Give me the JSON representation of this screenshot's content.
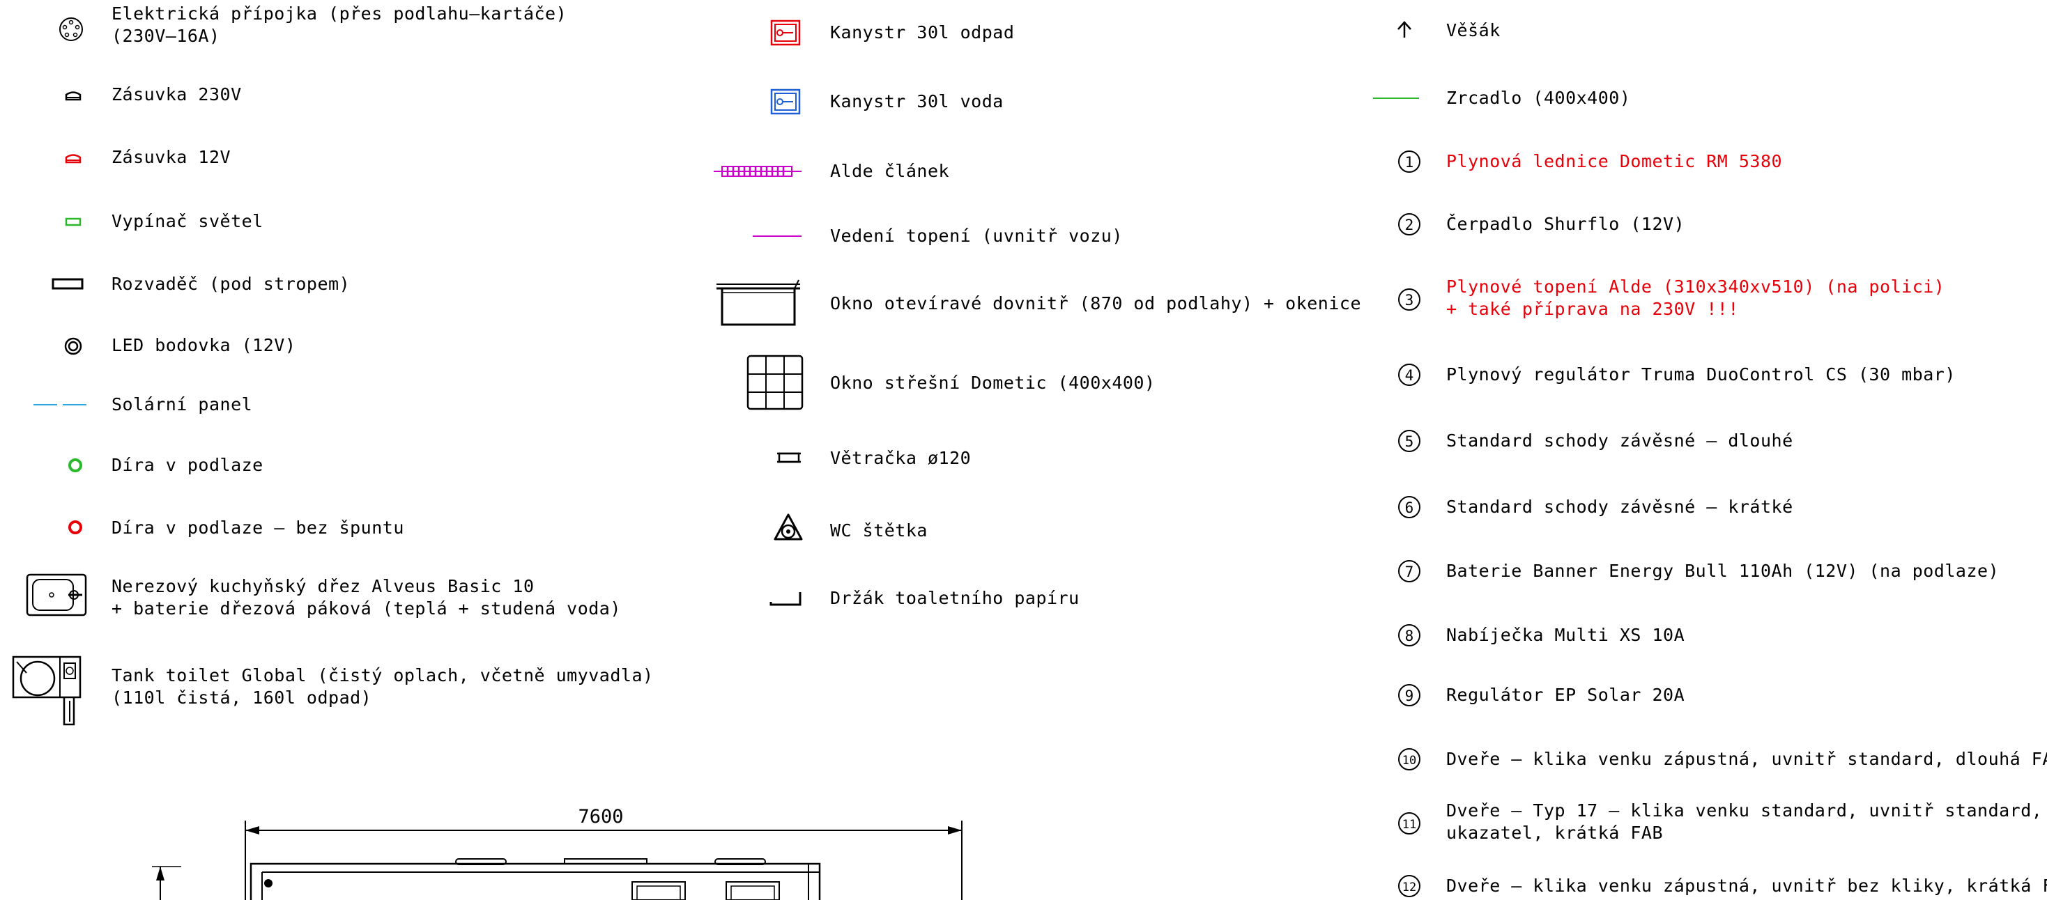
{
  "legend": {
    "col1": [
      {
        "id": "elektricka-pripojka",
        "icon": "power-inlet-icon",
        "lines": [
          "Elektrická přípojka (přes podlahu–kartáče)",
          "(230V–16A)"
        ]
      },
      {
        "id": "zasuvka-230",
        "icon": "socket-230v-icon",
        "lines": [
          "Zásuvka 230V"
        ]
      },
      {
        "id": "zasuvka-12",
        "icon": "socket-12v-icon",
        "lines": [
          "Zásuvka 12V"
        ]
      },
      {
        "id": "vypinac",
        "icon": "light-switch-icon",
        "lines": [
          "Vypínač světel"
        ]
      },
      {
        "id": "rozvadec",
        "icon": "distribution-board-icon",
        "lines": [
          "Rozvaděč (pod stropem)"
        ]
      },
      {
        "id": "led",
        "icon": "led-spotlight-icon",
        "lines": [
          "LED bodovka (12V)"
        ]
      },
      {
        "id": "solar",
        "icon": "solar-panel-line-icon",
        "lines": [
          "Solární panel"
        ]
      },
      {
        "id": "dira",
        "icon": "floor-hole-icon",
        "lines": [
          "Díra v podlaze"
        ]
      },
      {
        "id": "dira-bez",
        "icon": "floor-hole-open-icon",
        "lines": [
          "Díra v podlaze – bez špuntu"
        ]
      },
      {
        "id": "drez",
        "icon": "sink-icon",
        "lines": [
          "Nerezový kuchyňský dřez Alveus Basic 10",
          "+ baterie dřezová páková (teplá + studená voda)"
        ]
      },
      {
        "id": "toilet",
        "icon": "toilet-icon",
        "lines": [
          "Tank toilet Global (čistý oplach, včetně umyvadla)",
          "(110l čistá, 160l odpad)"
        ]
      }
    ],
    "col2": [
      {
        "id": "kanystr-odpad",
        "icon": "waste-canister-icon",
        "lines": [
          "Kanystr 30l odpad"
        ]
      },
      {
        "id": "kanystr-voda",
        "icon": "water-canister-icon",
        "lines": [
          "Kanystr 30l voda"
        ]
      },
      {
        "id": "alde-clanek",
        "icon": "alde-radiator-icon",
        "lines": [
          "Alde článek"
        ]
      },
      {
        "id": "vedeni-topeni",
        "icon": "heating-pipe-line-icon",
        "lines": [
          "Vedení topení (uvnitř vozu)"
        ]
      },
      {
        "id": "okno-otevirave",
        "icon": "opening-window-icon",
        "lines": [
          "Okno otevíravé dovnitř (870 od podlahy) + okenice"
        ]
      },
      {
        "id": "okno-stresni",
        "icon": "roof-window-icon",
        "lines": [
          "Okno střešní Dometic (400x400)"
        ]
      },
      {
        "id": "vetracka",
        "icon": "vent-icon",
        "lines": [
          "Větračka ø120"
        ]
      },
      {
        "id": "wc-stetka",
        "icon": "toilet-brush-icon",
        "lines": [
          "WC štětka"
        ]
      },
      {
        "id": "drzak-papiru",
        "icon": "paper-holder-icon",
        "lines": [
          "Držák toaletního papíru"
        ]
      }
    ],
    "col3": [
      {
        "id": "vesak",
        "marker": "↟",
        "lines": [
          "Věšák"
        ]
      },
      {
        "id": "zrcadlo",
        "marker": "",
        "lines": [
          "Zrcadlo (400x400)"
        ]
      },
      {
        "id": "n1",
        "marker": "1",
        "lines": [
          "Plynová lednice Dometic RM 5380"
        ],
        "red": true
      },
      {
        "id": "n2",
        "marker": "2",
        "lines": [
          "Čerpadlo Shurflo (12V)"
        ]
      },
      {
        "id": "n3",
        "marker": "3",
        "lines": [
          "Plynové topení Alde (310x340xv510) (na polici)",
          "+ také příprava na 230V !!!"
        ],
        "red": true
      },
      {
        "id": "n4",
        "marker": "4",
        "lines": [
          "Plynový regulátor Truma DuoControl CS (30 mbar)"
        ]
      },
      {
        "id": "n5",
        "marker": "5",
        "lines": [
          "Standard schody závěsné – dlouhé"
        ]
      },
      {
        "id": "n6",
        "marker": "6",
        "lines": [
          "Standard schody závěsné – krátké"
        ]
      },
      {
        "id": "n7",
        "marker": "7",
        "lines": [
          "Baterie Banner Energy Bull 110Ah (12V) (na podlaze)"
        ]
      },
      {
        "id": "n8",
        "marker": "8",
        "lines": [
          "Nabíječka Multi XS 10A"
        ]
      },
      {
        "id": "n9",
        "marker": "9",
        "lines": [
          "Regulátor EP Solar 20A"
        ]
      },
      {
        "id": "n10",
        "marker": "10",
        "lines": [
          "Dveře – klika venku zápustná, uvnitř standard, dlouhá FAB"
        ]
      },
      {
        "id": "n11",
        "marker": "11",
        "lines": [
          "Dveře – Typ 17 – klika venku standard, uvnitř standard,",
          "ukazatel, krátká FAB"
        ]
      },
      {
        "id": "n12",
        "marker": "12",
        "lines": [
          "Dveře – klika venku zápustná, uvnitř bez kliky, krátká FAB"
        ]
      }
    ]
  },
  "drawing": {
    "dimension": "7600"
  },
  "colors": {
    "red": "#e6000a",
    "green": "#2db82d",
    "blue": "#1f5fd6",
    "magenta": "#cc00cc",
    "cyan": "#2aa7e0"
  }
}
